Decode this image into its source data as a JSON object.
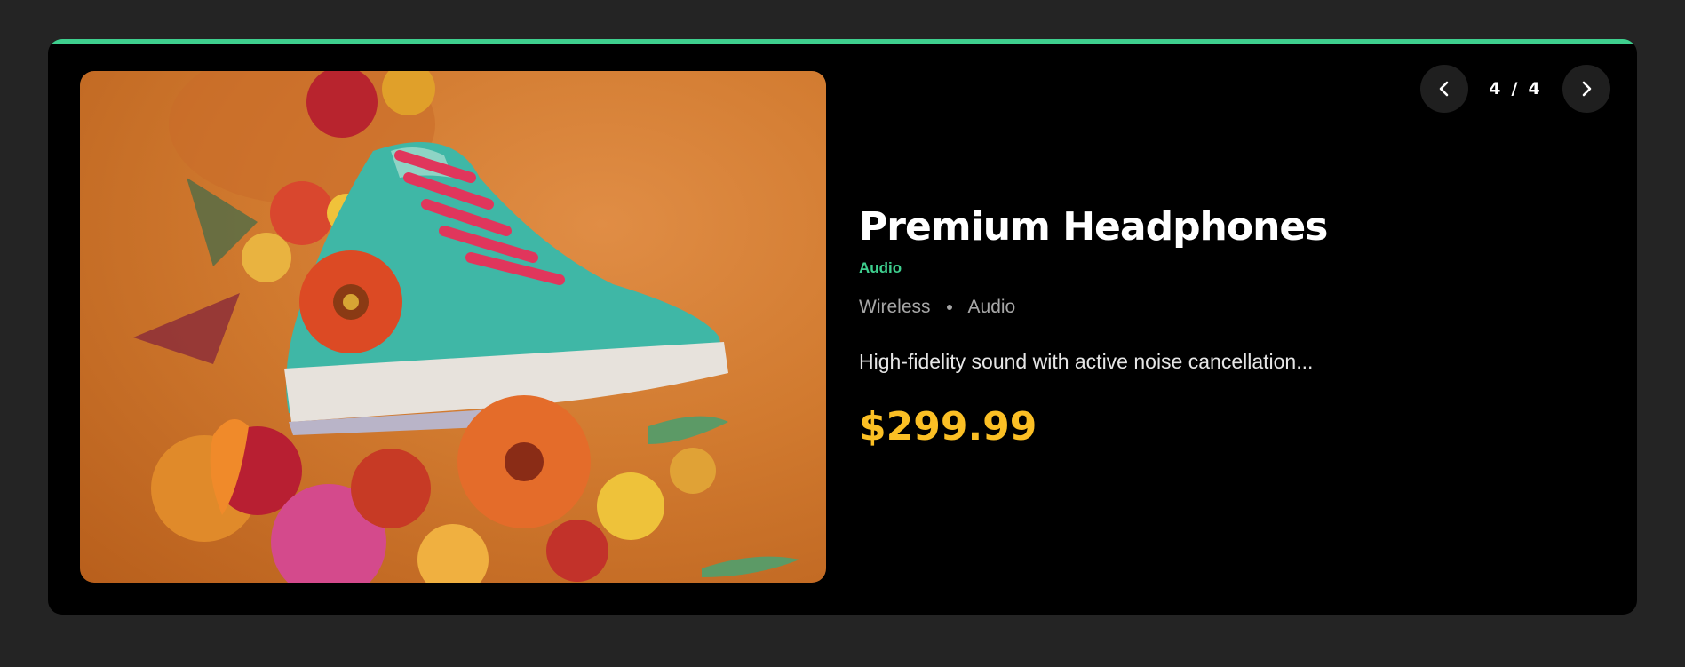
{
  "product": {
    "title": "Premium Headphones",
    "category": "Audio",
    "tags": [
      "Wireless",
      "Audio"
    ],
    "description": "High-fidelity sound with active noise cancellation...",
    "price": "$299.99",
    "image_subject": "sneaker with flowers"
  },
  "carousel": {
    "current": "4",
    "separator": "/",
    "total": "4",
    "prev_icon": "chevron-left-icon",
    "next_icon": "chevron-right-icon"
  },
  "colors": {
    "accent": "#3ecf8e",
    "price": "#fbbf24",
    "page_background": "#242424",
    "card_background": "#000000"
  }
}
